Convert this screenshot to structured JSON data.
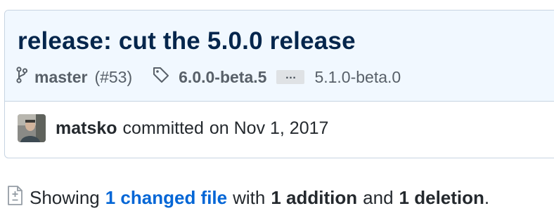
{
  "commit": {
    "title": "release: cut the 5.0.0 release",
    "branch": "master",
    "pr_ref": "(#53)",
    "tag": "6.0.0-beta.5",
    "ellipsis": "…",
    "tag_other": "5.1.0-beta.0",
    "author": "matsko",
    "committed_text": "committed",
    "date": "on Nov 1, 2017"
  },
  "summary": {
    "showing": "Showing",
    "changed_files": "1 changed file",
    "with": "with",
    "additions": "1 addition",
    "and": "and",
    "deletions": "1 deletion",
    "period": "."
  },
  "icons": {
    "branch": "git-branch-icon",
    "tag": "tag-icon",
    "diff": "file-diff-icon"
  },
  "colors": {
    "header_bg": "#f1f8ff",
    "title": "#05264c",
    "link": "#0366d6",
    "muted": "#586069"
  }
}
